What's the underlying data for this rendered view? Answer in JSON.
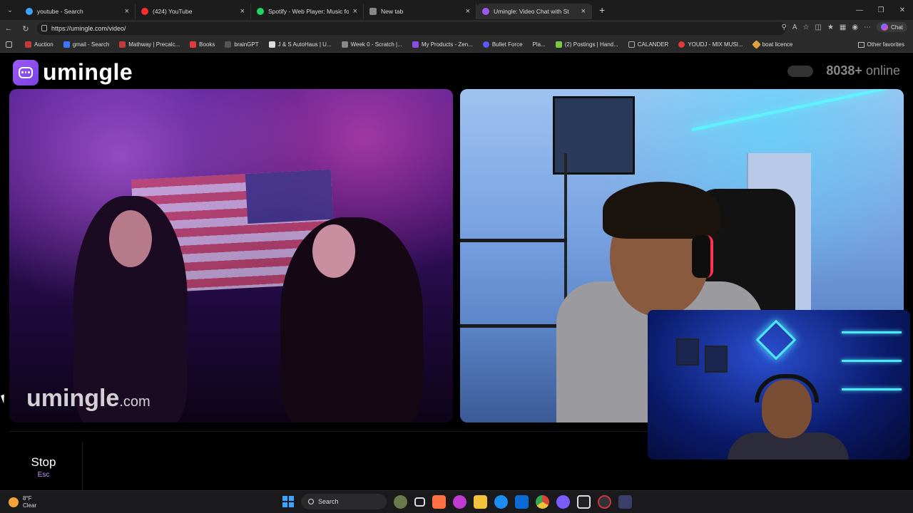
{
  "browser": {
    "tabs": [
      {
        "label": "youtube - Search",
        "color": "#3aa6ff",
        "active": false
      },
      {
        "label": "(424) YouTube",
        "color": "#ff2d2d",
        "active": false
      },
      {
        "label": "Spotify - Web Player: Music for ev",
        "color": "#1ed760",
        "active": false
      },
      {
        "label": "New tab",
        "color": "#888888",
        "active": false
      },
      {
        "label": "Umingle: Video Chat with St",
        "color": "#9b5cf5",
        "active": true
      }
    ],
    "url": "https://umingle.com/video/",
    "chat_label": "Chat",
    "bookmarks": [
      {
        "label": "Auction",
        "color": "#c23b3b"
      },
      {
        "label": "gmail - Search",
        "color": "#3a78ff"
      },
      {
        "label": "Mathway | Precalc...",
        "color": "#c23b3b"
      },
      {
        "label": "Books",
        "color": "#e23b3b"
      },
      {
        "label": "brainGPT",
        "color": "#444"
      },
      {
        "label": "J & S AutoHaus | U...",
        "color": "#ddd"
      },
      {
        "label": "Week 0 - Scratch |...",
        "color": "#888"
      },
      {
        "label": "My Products - Zen...",
        "color": "#8a4be2"
      },
      {
        "label": "Bullet Force",
        "color": "#5a5aff"
      },
      {
        "label": "Pla...",
        "color": "#888"
      },
      {
        "label": "(2) Postings | Hand...",
        "color": "#7ac943"
      },
      {
        "label": "CALANDER",
        "color": "#aaa"
      },
      {
        "label": "YOUDJ - MIX MUSI...",
        "color": "#e23b3b"
      },
      {
        "label": "boat licence",
        "color": "#e2a23b"
      }
    ],
    "other_favorites": "Other favorites"
  },
  "site": {
    "logo": "umingle",
    "online_count": "8038+",
    "online_label": "online",
    "watermark_main": "umingle",
    "watermark_suffix": ".com",
    "stop_label": "Stop",
    "stop_shortcut": "Esc"
  },
  "taskbar": {
    "temperature": "8°F",
    "condition": "Clear",
    "search_label": "Search",
    "apps": [
      "#6a7a4a",
      "#dddddd",
      "#ff7043",
      "#c03ad0",
      "#f2c23a",
      "#1d8df0",
      "#0b6ad6",
      "#e34133",
      "#7b5cff",
      "#dddddd",
      "#cc3344",
      "#3a3f6a"
    ]
  }
}
